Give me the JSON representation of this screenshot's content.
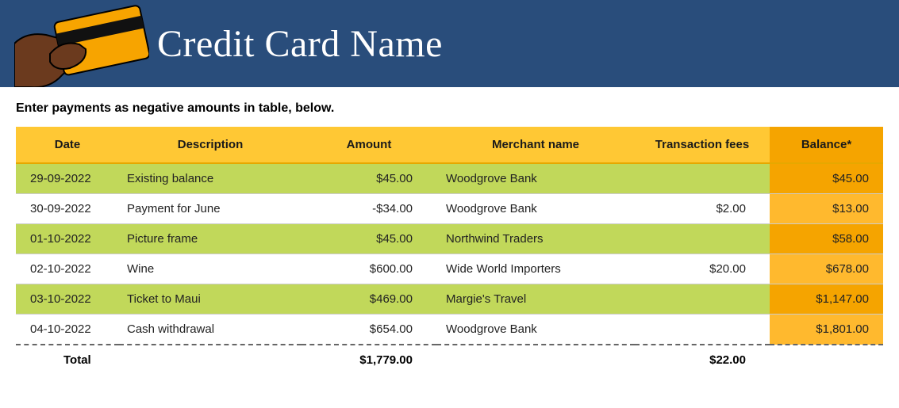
{
  "header": {
    "title": "Credit Card Name"
  },
  "instruction": "Enter payments as negative amounts in table, below.",
  "columns": {
    "date": "Date",
    "description": "Description",
    "amount": "Amount",
    "merchant": "Merchant name",
    "fees": "Transaction fees",
    "balance": "Balance*"
  },
  "rows": [
    {
      "date": "29-09-2022",
      "description": "Existing balance",
      "amount": "$45.00",
      "merchant": "Woodgrove Bank",
      "fee": "",
      "balance": "$45.00"
    },
    {
      "date": "30-09-2022",
      "description": "Payment for June",
      "amount": "-$34.00",
      "merchant": "Woodgrove Bank",
      "fee": "$2.00",
      "balance": "$13.00"
    },
    {
      "date": "01-10-2022",
      "description": "Picture frame",
      "amount": "$45.00",
      "merchant": "Northwind Traders",
      "fee": "",
      "balance": "$58.00"
    },
    {
      "date": "02-10-2022",
      "description": "Wine",
      "amount": "$600.00",
      "merchant": "Wide World Importers",
      "fee": "$20.00",
      "balance": "$678.00"
    },
    {
      "date": "03-10-2022",
      "description": "Ticket to Maui",
      "amount": "$469.00",
      "merchant": "Margie's Travel",
      "fee": "",
      "balance": "$1,147.00"
    },
    {
      "date": "04-10-2022",
      "description": "Cash withdrawal",
      "amount": "$654.00",
      "merchant": "Woodgrove Bank",
      "fee": "",
      "balance": "$1,801.00"
    }
  ],
  "totals": {
    "label": "Total",
    "amount": "$1,779.00",
    "fees": "$22.00"
  }
}
